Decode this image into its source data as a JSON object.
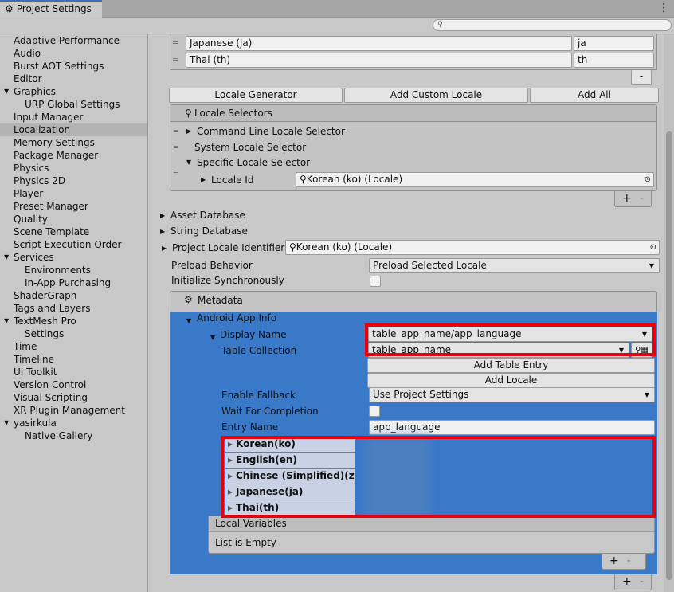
{
  "window": {
    "tab_title": "Project Settings",
    "menu_icon": "kebab-icon"
  },
  "search": {
    "icon": "search-icon",
    "placeholder": ""
  },
  "sidebar": {
    "items": [
      {
        "label": "Adaptive Performance",
        "level": 0
      },
      {
        "label": "Audio",
        "level": 0
      },
      {
        "label": "Burst AOT Settings",
        "level": 0
      },
      {
        "label": "Editor",
        "level": 0
      },
      {
        "label": "Graphics",
        "level": 0,
        "expanded": true
      },
      {
        "label": "URP Global Settings",
        "level": 1
      },
      {
        "label": "Input Manager",
        "level": 0
      },
      {
        "label": "Localization",
        "level": 0,
        "selected": true
      },
      {
        "label": "Memory Settings",
        "level": 0
      },
      {
        "label": "Package Manager",
        "level": 0
      },
      {
        "label": "Physics",
        "level": 0
      },
      {
        "label": "Physics 2D",
        "level": 0
      },
      {
        "label": "Player",
        "level": 0
      },
      {
        "label": "Preset Manager",
        "level": 0
      },
      {
        "label": "Quality",
        "level": 0
      },
      {
        "label": "Scene Template",
        "level": 0
      },
      {
        "label": "Script Execution Order",
        "level": 0
      },
      {
        "label": "Services",
        "level": 0,
        "expanded": true
      },
      {
        "label": "Environments",
        "level": 1
      },
      {
        "label": "In-App Purchasing",
        "level": 1
      },
      {
        "label": "ShaderGraph",
        "level": 0
      },
      {
        "label": "Tags and Layers",
        "level": 0
      },
      {
        "label": "TextMesh Pro",
        "level": 0,
        "expanded": true
      },
      {
        "label": "Settings",
        "level": 1
      },
      {
        "label": "Time",
        "level": 0
      },
      {
        "label": "Timeline",
        "level": 0
      },
      {
        "label": "UI Toolkit",
        "level": 0
      },
      {
        "label": "Version Control",
        "level": 0
      },
      {
        "label": "Visual Scripting",
        "level": 0
      },
      {
        "label": "XR Plugin Management",
        "level": 0
      },
      {
        "label": "yasirkula",
        "level": 0,
        "expanded": true
      },
      {
        "label": "Native Gallery",
        "level": 1
      }
    ]
  },
  "locales": {
    "rows": [
      {
        "name": "Japanese (ja)",
        "code": "ja"
      },
      {
        "name": "Thai (th)",
        "code": "th"
      }
    ],
    "minus": "-",
    "buttons": {
      "generator": "Locale Generator",
      "add_custom": "Add Custom Locale",
      "add_all": "Add All"
    }
  },
  "locale_selectors": {
    "title": "Locale Selectors",
    "items": [
      "Command Line Locale Selector",
      "System Locale Selector",
      "Specific Locale Selector"
    ],
    "locale_id_label": "Locale Id",
    "locale_id_value": "Korean (ko) (Locale)",
    "plus": "+",
    "minus": "-"
  },
  "settings": {
    "asset_database": "Asset Database",
    "string_database": "String Database",
    "project_locale_label": "Project Locale Identifier",
    "project_locale_value": "Korean (ko) (Locale)",
    "preload_label": "Preload Behavior",
    "preload_value": "Preload Selected Locale",
    "init_sync_label": "Initialize Synchronously"
  },
  "metadata": {
    "title": "Metadata",
    "android_app_info": "Android App Info",
    "display_name_label": "Display Name",
    "display_name_value": "table_app_name/app_language",
    "table_collection_label": "Table Collection",
    "table_collection_value": "table_app_name",
    "add_table_entry": "Add Table Entry",
    "add_locale": "Add Locale",
    "enable_fallback_label": "Enable Fallback",
    "enable_fallback_value": "Use Project Settings",
    "wait_label": "Wait For Completion",
    "entry_name_label": "Entry Name",
    "entry_name_value": "app_language",
    "locale_entries": [
      "Korean(ko)",
      "English(en)",
      "Chinese (Simplified)(zh",
      "Japanese(ja)",
      "Thai(th)"
    ],
    "local_variables_title": "Local Variables",
    "local_variables_empty": "List is Empty",
    "plus": "+",
    "minus": "-",
    "highlight_color": "#e8000e",
    "selection_color": "#3a78c8"
  }
}
